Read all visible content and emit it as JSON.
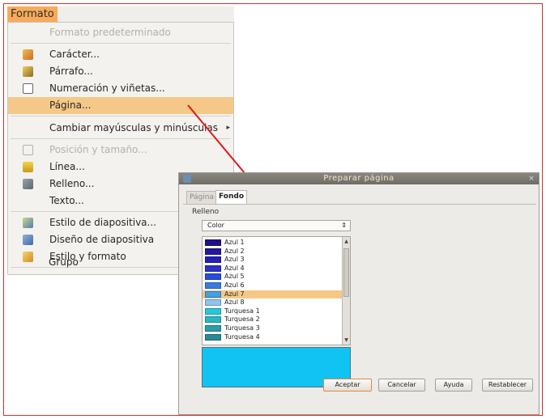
{
  "menu": {
    "title": "Formato",
    "items": [
      {
        "label": "Formato predeterminado",
        "disabled": true,
        "icon": ""
      },
      {
        "label": "Carácter...",
        "icon": "character-icon"
      },
      {
        "label": "Párrafo...",
        "icon": "paragraph-icon"
      },
      {
        "label": "Numeración y viñetas...",
        "icon": "bullets-icon"
      },
      {
        "label": "Página...",
        "highlighted": true,
        "icon": ""
      },
      {
        "label": "Cambiar mayúsculas y minúsculas",
        "icon": ""
      },
      {
        "label": "Posición y tamaño...",
        "disabled": true,
        "icon": "position-icon"
      },
      {
        "label": "Línea...",
        "icon": "line-icon"
      },
      {
        "label": "Relleno...",
        "icon": "fill-icon"
      },
      {
        "label": "Texto...",
        "icon": ""
      },
      {
        "label": "Estilo de diapositiva...",
        "icon": "slide-style-icon"
      },
      {
        "label": "Diseño de diapositiva",
        "icon": "slide-layout-icon"
      },
      {
        "label": "Estilo y formato",
        "icon": "styles-icon"
      },
      {
        "label": "Grupo",
        "icon": ""
      }
    ],
    "submenu_arrow": "▸"
  },
  "dialog": {
    "title": "Preparar página",
    "close": "×",
    "tabs": [
      "Página",
      "Fondo"
    ],
    "active_tab": "Fondo",
    "section_label": "Relleno",
    "fill_select_value": "Color",
    "fill_select_arrow": "⇕",
    "colors": [
      {
        "name": "Azul 1",
        "hex": "#1f0f8c"
      },
      {
        "name": "Azul 2",
        "hex": "#24199c"
      },
      {
        "name": "Azul 3",
        "hex": "#2420b2"
      },
      {
        "name": "Azul 4",
        "hex": "#2a32c8"
      },
      {
        "name": "Azul 5",
        "hex": "#2a4ae0"
      },
      {
        "name": "Azul 6",
        "hex": "#3a7ddd"
      },
      {
        "name": "Azul 7",
        "hex": "#43a0e8",
        "selected": true
      },
      {
        "name": "Azul 8",
        "hex": "#8fc3f0"
      },
      {
        "name": "Turquesa 1",
        "hex": "#25c8d9"
      },
      {
        "name": "Turquesa 2",
        "hex": "#29b7c4"
      },
      {
        "name": "Turquesa 3",
        "hex": "#2a9ea8"
      },
      {
        "name": "Turquesa 4",
        "hex": "#2a8a93"
      }
    ],
    "preview_color": "#10c3f3",
    "buttons": {
      "accept": "Aceptar",
      "cancel": "Cancelar",
      "help": "Ayuda",
      "reset": "Restablecer"
    }
  }
}
